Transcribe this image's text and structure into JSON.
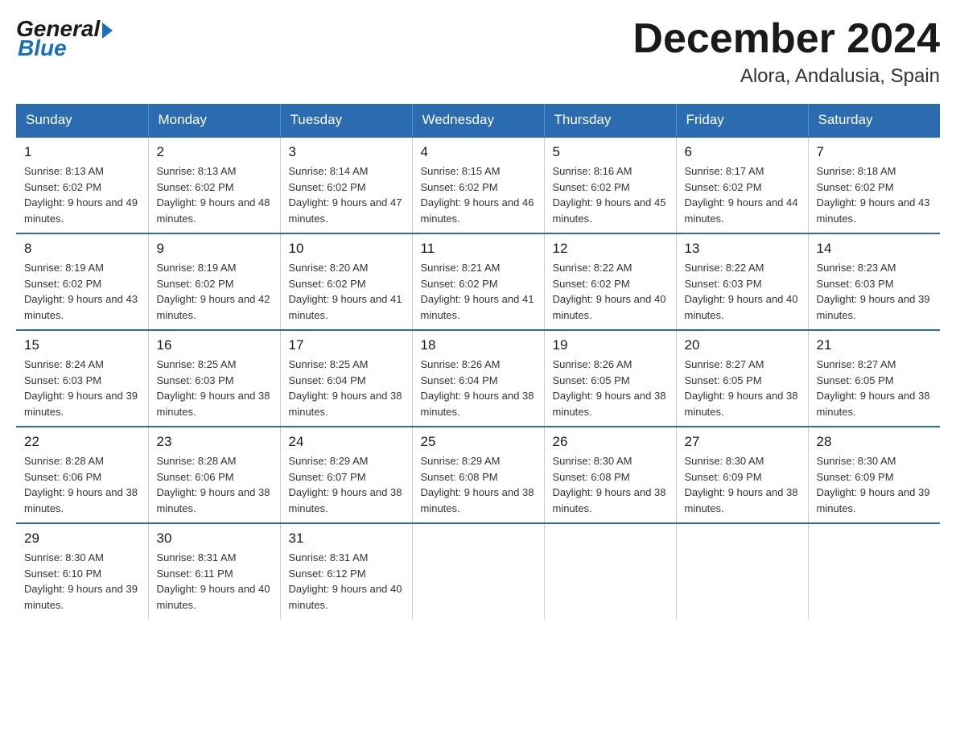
{
  "header": {
    "logo_general": "General",
    "logo_blue": "Blue",
    "month_title": "December 2024",
    "location": "Alora, Andalusia, Spain"
  },
  "weekdays": [
    "Sunday",
    "Monday",
    "Tuesday",
    "Wednesday",
    "Thursday",
    "Friday",
    "Saturday"
  ],
  "weeks": [
    [
      {
        "day": "1",
        "sunrise": "Sunrise: 8:13 AM",
        "sunset": "Sunset: 6:02 PM",
        "daylight": "Daylight: 9 hours and 49 minutes."
      },
      {
        "day": "2",
        "sunrise": "Sunrise: 8:13 AM",
        "sunset": "Sunset: 6:02 PM",
        "daylight": "Daylight: 9 hours and 48 minutes."
      },
      {
        "day": "3",
        "sunrise": "Sunrise: 8:14 AM",
        "sunset": "Sunset: 6:02 PM",
        "daylight": "Daylight: 9 hours and 47 minutes."
      },
      {
        "day": "4",
        "sunrise": "Sunrise: 8:15 AM",
        "sunset": "Sunset: 6:02 PM",
        "daylight": "Daylight: 9 hours and 46 minutes."
      },
      {
        "day": "5",
        "sunrise": "Sunrise: 8:16 AM",
        "sunset": "Sunset: 6:02 PM",
        "daylight": "Daylight: 9 hours and 45 minutes."
      },
      {
        "day": "6",
        "sunrise": "Sunrise: 8:17 AM",
        "sunset": "Sunset: 6:02 PM",
        "daylight": "Daylight: 9 hours and 44 minutes."
      },
      {
        "day": "7",
        "sunrise": "Sunrise: 8:18 AM",
        "sunset": "Sunset: 6:02 PM",
        "daylight": "Daylight: 9 hours and 43 minutes."
      }
    ],
    [
      {
        "day": "8",
        "sunrise": "Sunrise: 8:19 AM",
        "sunset": "Sunset: 6:02 PM",
        "daylight": "Daylight: 9 hours and 43 minutes."
      },
      {
        "day": "9",
        "sunrise": "Sunrise: 8:19 AM",
        "sunset": "Sunset: 6:02 PM",
        "daylight": "Daylight: 9 hours and 42 minutes."
      },
      {
        "day": "10",
        "sunrise": "Sunrise: 8:20 AM",
        "sunset": "Sunset: 6:02 PM",
        "daylight": "Daylight: 9 hours and 41 minutes."
      },
      {
        "day": "11",
        "sunrise": "Sunrise: 8:21 AM",
        "sunset": "Sunset: 6:02 PM",
        "daylight": "Daylight: 9 hours and 41 minutes."
      },
      {
        "day": "12",
        "sunrise": "Sunrise: 8:22 AM",
        "sunset": "Sunset: 6:02 PM",
        "daylight": "Daylight: 9 hours and 40 minutes."
      },
      {
        "day": "13",
        "sunrise": "Sunrise: 8:22 AM",
        "sunset": "Sunset: 6:03 PM",
        "daylight": "Daylight: 9 hours and 40 minutes."
      },
      {
        "day": "14",
        "sunrise": "Sunrise: 8:23 AM",
        "sunset": "Sunset: 6:03 PM",
        "daylight": "Daylight: 9 hours and 39 minutes."
      }
    ],
    [
      {
        "day": "15",
        "sunrise": "Sunrise: 8:24 AM",
        "sunset": "Sunset: 6:03 PM",
        "daylight": "Daylight: 9 hours and 39 minutes."
      },
      {
        "day": "16",
        "sunrise": "Sunrise: 8:25 AM",
        "sunset": "Sunset: 6:03 PM",
        "daylight": "Daylight: 9 hours and 38 minutes."
      },
      {
        "day": "17",
        "sunrise": "Sunrise: 8:25 AM",
        "sunset": "Sunset: 6:04 PM",
        "daylight": "Daylight: 9 hours and 38 minutes."
      },
      {
        "day": "18",
        "sunrise": "Sunrise: 8:26 AM",
        "sunset": "Sunset: 6:04 PM",
        "daylight": "Daylight: 9 hours and 38 minutes."
      },
      {
        "day": "19",
        "sunrise": "Sunrise: 8:26 AM",
        "sunset": "Sunset: 6:05 PM",
        "daylight": "Daylight: 9 hours and 38 minutes."
      },
      {
        "day": "20",
        "sunrise": "Sunrise: 8:27 AM",
        "sunset": "Sunset: 6:05 PM",
        "daylight": "Daylight: 9 hours and 38 minutes."
      },
      {
        "day": "21",
        "sunrise": "Sunrise: 8:27 AM",
        "sunset": "Sunset: 6:05 PM",
        "daylight": "Daylight: 9 hours and 38 minutes."
      }
    ],
    [
      {
        "day": "22",
        "sunrise": "Sunrise: 8:28 AM",
        "sunset": "Sunset: 6:06 PM",
        "daylight": "Daylight: 9 hours and 38 minutes."
      },
      {
        "day": "23",
        "sunrise": "Sunrise: 8:28 AM",
        "sunset": "Sunset: 6:06 PM",
        "daylight": "Daylight: 9 hours and 38 minutes."
      },
      {
        "day": "24",
        "sunrise": "Sunrise: 8:29 AM",
        "sunset": "Sunset: 6:07 PM",
        "daylight": "Daylight: 9 hours and 38 minutes."
      },
      {
        "day": "25",
        "sunrise": "Sunrise: 8:29 AM",
        "sunset": "Sunset: 6:08 PM",
        "daylight": "Daylight: 9 hours and 38 minutes."
      },
      {
        "day": "26",
        "sunrise": "Sunrise: 8:30 AM",
        "sunset": "Sunset: 6:08 PM",
        "daylight": "Daylight: 9 hours and 38 minutes."
      },
      {
        "day": "27",
        "sunrise": "Sunrise: 8:30 AM",
        "sunset": "Sunset: 6:09 PM",
        "daylight": "Daylight: 9 hours and 38 minutes."
      },
      {
        "day": "28",
        "sunrise": "Sunrise: 8:30 AM",
        "sunset": "Sunset: 6:09 PM",
        "daylight": "Daylight: 9 hours and 39 minutes."
      }
    ],
    [
      {
        "day": "29",
        "sunrise": "Sunrise: 8:30 AM",
        "sunset": "Sunset: 6:10 PM",
        "daylight": "Daylight: 9 hours and 39 minutes."
      },
      {
        "day": "30",
        "sunrise": "Sunrise: 8:31 AM",
        "sunset": "Sunset: 6:11 PM",
        "daylight": "Daylight: 9 hours and 40 minutes."
      },
      {
        "day": "31",
        "sunrise": "Sunrise: 8:31 AM",
        "sunset": "Sunset: 6:12 PM",
        "daylight": "Daylight: 9 hours and 40 minutes."
      },
      null,
      null,
      null,
      null
    ]
  ]
}
